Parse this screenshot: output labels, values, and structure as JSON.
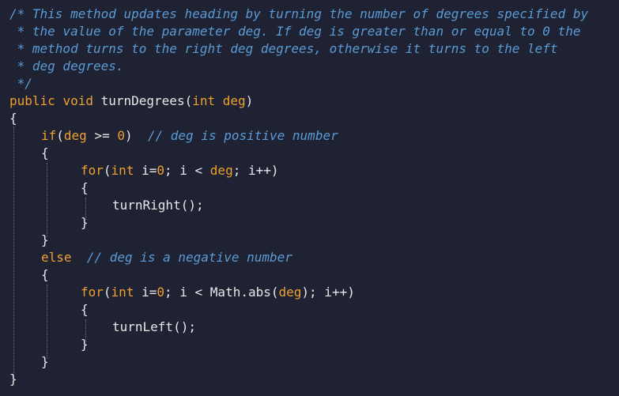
{
  "code": {
    "comment_lines": [
      "/* This method updates heading by turning the number of degrees specified by",
      " * the value of the parameter deg. If deg is greater than or equal to 0 the",
      " * method turns to the right deg degrees, otherwise it turns to the left",
      " * deg degrees.",
      " */"
    ],
    "signature": {
      "modifier": "public",
      "return_type": "void",
      "name": "turnDegrees(",
      "param_type": "int",
      "param_name": "deg",
      "close": ")"
    },
    "open_brace_outer": "{",
    "if_line": {
      "keyword": "if",
      "open": "(",
      "var": "deg",
      "op": " >= ",
      "value": "0",
      "close": ")",
      "comment": "// deg is positive number"
    },
    "if_open_brace": "{",
    "for1": {
      "keyword": "for",
      "open": "(",
      "type": "int",
      "init": " i=",
      "init_val": "0",
      "cond_a": "; i < ",
      "cond_var": "deg",
      "rest": "; i++)"
    },
    "for1_open": "{",
    "call_right": "turnRight();",
    "for1_close": "}",
    "if_close_brace": "}",
    "else_line": {
      "keyword": "else",
      "comment": "// deg is a negative number"
    },
    "else_open_brace": "{",
    "for2": {
      "keyword": "for",
      "open": "(",
      "type": "int",
      "init": " i=",
      "init_val": "0",
      "cond_a": "; i < Math.abs(",
      "cond_var": "deg",
      "rest": "); i++)"
    },
    "for2_open": "{",
    "call_left": "turnLeft();",
    "for2_close": "}",
    "else_close_brace": "}",
    "close_brace_outer": "}"
  }
}
